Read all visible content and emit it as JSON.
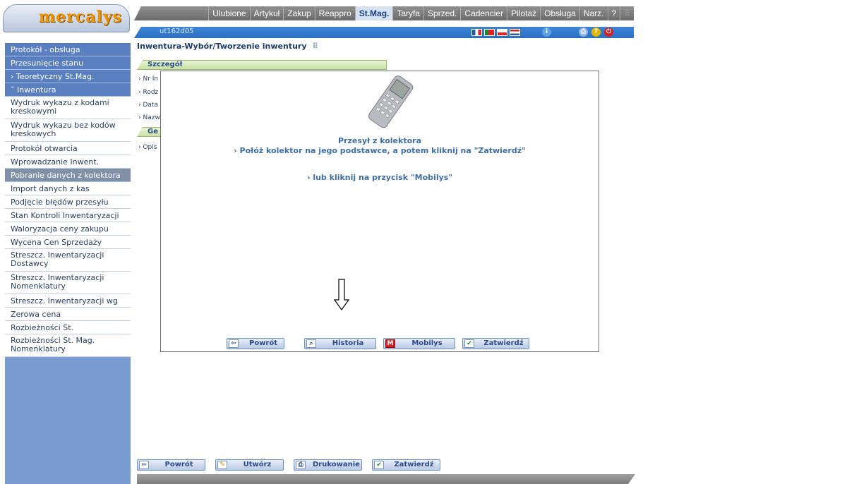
{
  "logo": {
    "text": "mercalys"
  },
  "top_menu": [
    "Ulubione",
    "Artykuł",
    "Zakup",
    "Reappro",
    "St.Mag.",
    "Taryfa",
    "Sprzed.",
    "Cadencier",
    "Pilotaż",
    "Obsługa",
    "Narz.",
    "?"
  ],
  "top_menu_active": "St.Mag.",
  "info_bar": {
    "user": "ut162d05"
  },
  "sidebar": [
    {
      "label": "Protokół - obsługa",
      "style": "dark"
    },
    {
      "label": "Przesunięcie stanu",
      "style": "dark"
    },
    {
      "label": "Teoretyczny St.Mag.",
      "style": "dark",
      "arrow": "›"
    },
    {
      "label": "Inwentura",
      "style": "dark",
      "arrow": "˅"
    },
    {
      "label": "Wydruk wykazu z kodami kreskowymi",
      "style": "white"
    },
    {
      "label": "Wydruk wykazu bez kodów kreskowych",
      "style": "white"
    },
    {
      "label": "Protokół otwarcia",
      "style": "white"
    },
    {
      "label": "Wprowadzanie Inwent.",
      "style": "white"
    },
    {
      "label": "Pobranie danych z kolektora",
      "style": "sel"
    },
    {
      "label": "Import danych z kas",
      "style": "white"
    },
    {
      "label": "Podjęcie błędów przesyłu",
      "style": "white"
    },
    {
      "label": "Stan Kontroli Inwentaryzacji",
      "style": "white"
    },
    {
      "label": "Waloryzacja ceny zakupu",
      "style": "white"
    },
    {
      "label": "Wycena Cen Sprzedaży",
      "style": "white"
    },
    {
      "label": "Streszcz. Inwentaryzacji Dostawcy",
      "style": "white"
    },
    {
      "label": "Streszcz. Inwentaryzacji Nomenklatury",
      "style": "white"
    },
    {
      "label": "Streszcz. Inwentaryzacji wg VAT",
      "style": "white"
    },
    {
      "label": "Zerowa cena",
      "style": "white"
    },
    {
      "label": "Rozbieżności St. Mag.Artykułu",
      "style": "white"
    },
    {
      "label": "Rozbieżności St. Mag. Nomenklatury",
      "style": "white"
    }
  ],
  "page_title": "Inwentura-Wybór/Tworzenie inwentury",
  "detail_panel": {
    "header": "Szczegół",
    "rows": [
      "Nr In",
      "Rodz",
      "Data",
      "Nazw"
    ],
    "header2": "Ge",
    "rows2": [
      "Opis"
    ]
  },
  "dialog": {
    "title": "Przesył z kolektora",
    "instruction": "Połóż kolektor na jego podstawce, a potem kliknij na \"Zatwierdź\"",
    "alternative": "lub kliknij na przycisk \"Mobilys\"",
    "buttons": {
      "back": "Powrót",
      "history": "Historia",
      "mobilys": "Mobilys",
      "confirm": "Zatwierdź"
    }
  },
  "bottom_buttons": {
    "back": "Powrót",
    "create": "Utwórz",
    "print": "Drukowanie",
    "confirm": "Zatwierdź"
  },
  "colors": {
    "sidebar": "#7b9cd1",
    "accent_orange": "#f29400",
    "panel_green": "#c9e3a4",
    "info_bar": "#2a6fc2"
  }
}
